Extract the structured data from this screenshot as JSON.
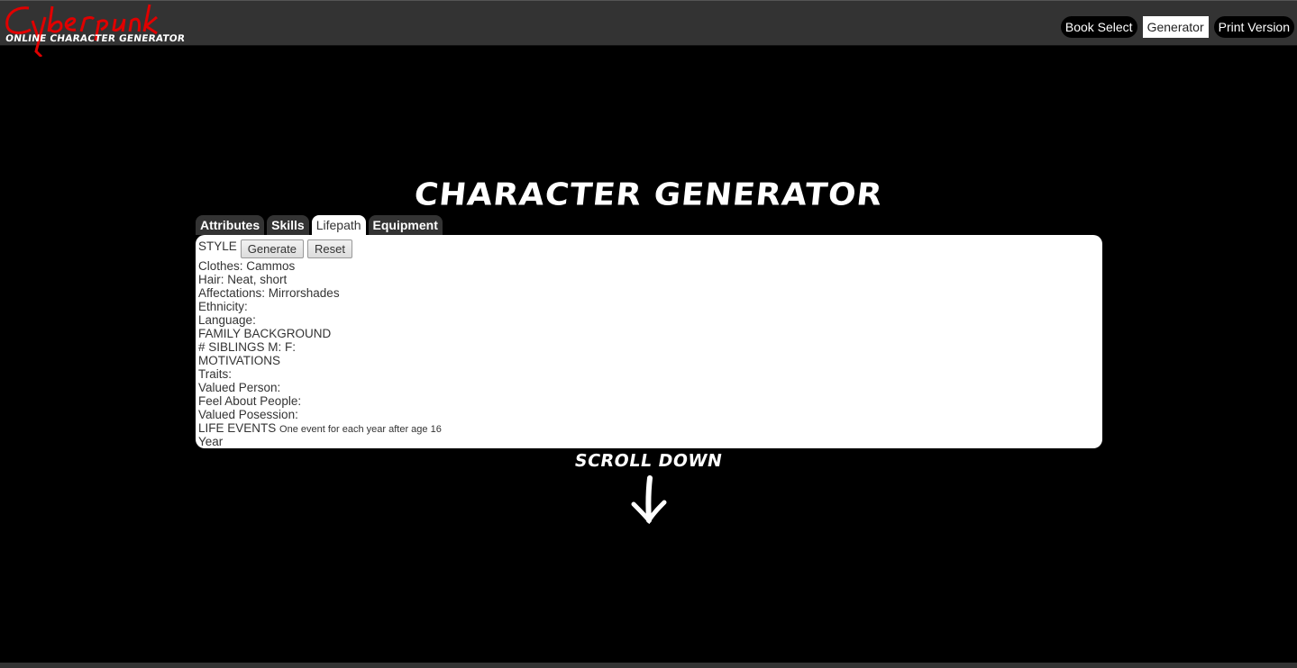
{
  "logo": {
    "title": "Cyberpunk",
    "subtitle": "Online Character Generator"
  },
  "nav": {
    "items": [
      "Book Select",
      "Generator",
      "Print Version"
    ],
    "active": "Generator"
  },
  "page": {
    "title": "Character Generator",
    "scroll_hint": "Scroll Down"
  },
  "tabs": [
    "Attributes",
    "Skills",
    "Lifepath",
    "Equipment"
  ],
  "active_tab": "Lifepath",
  "lifepath": {
    "style_label": "STYLE",
    "generate_label": "Generate",
    "reset_label": "Reset",
    "clothes": "Clothes: Cammos",
    "hair": "Hair: Neat, short",
    "affectations": "Affectations: Mirrorshades",
    "ethnicity": "Ethnicity:",
    "language": "Language:",
    "family_heading": "FAMILY BACKGROUND",
    "siblings": "# SIBLINGS M: F:",
    "motivations_heading": "MOTIVATIONS",
    "traits": "Traits:",
    "valued_person": "Valued Person:",
    "feel_about_people": "Feel About People:",
    "valued_posession": "Valued Posession:",
    "life_events_heading": "LIFE EVENTS",
    "life_events_note": "One event for each year after age 16",
    "year": "Year"
  },
  "colors": {
    "background": "#000000",
    "topbar": "#333333",
    "logo_red": "#e00000",
    "panel": "#ffffff"
  }
}
